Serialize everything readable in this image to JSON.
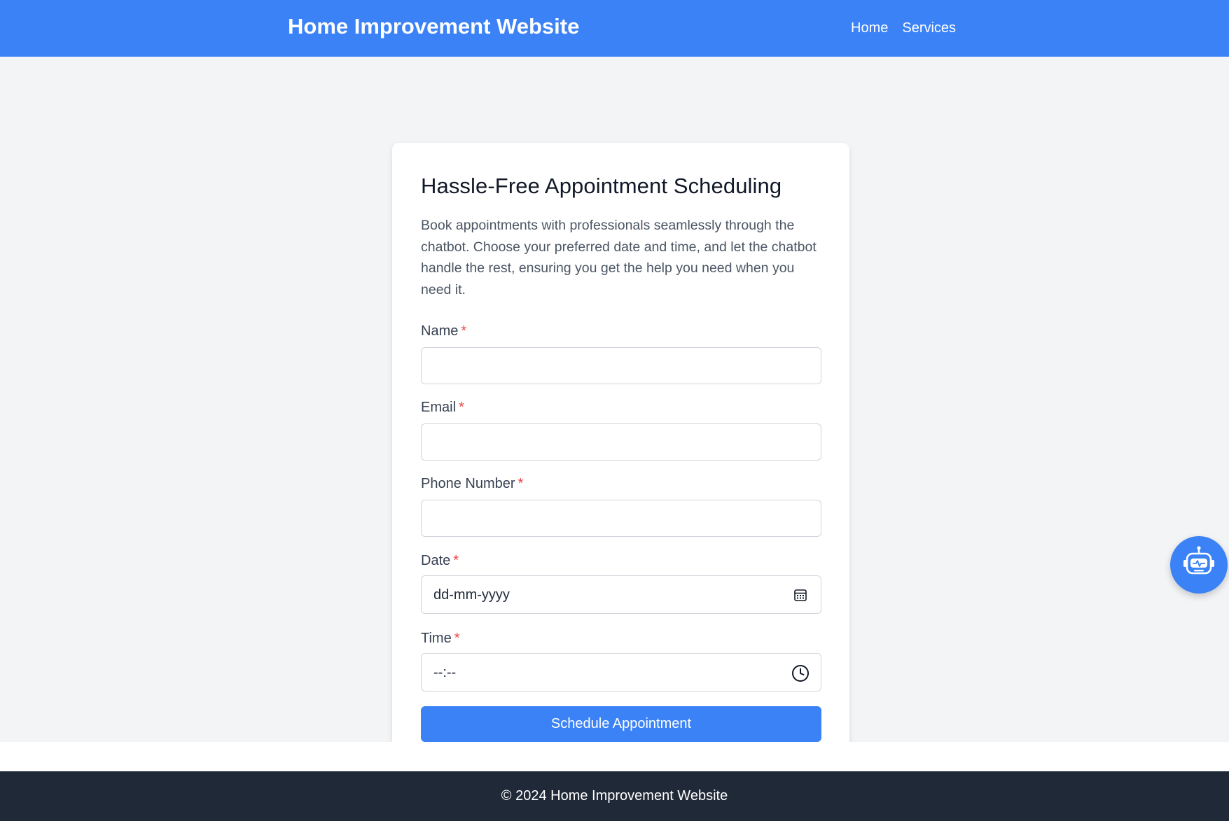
{
  "header": {
    "title": "Home Improvement Website",
    "nav": [
      "Home",
      "Services"
    ]
  },
  "card": {
    "title": "Hassle-Free Appointment Scheduling",
    "description": "Book appointments with professionals seamlessly through the chatbot. Choose your preferred date and time, and let the chatbot handle the rest, ensuring you get the help you need when you need it.",
    "fields": {
      "name": {
        "label": "Name",
        "required_mark": "*",
        "value": ""
      },
      "email": {
        "label": "Email",
        "required_mark": "*",
        "value": ""
      },
      "phone": {
        "label": "Phone Number",
        "required_mark": "*",
        "value": ""
      },
      "date": {
        "label": "Date",
        "required_mark": "*",
        "value": "dd-mm-yyyy",
        "icon": "calendar-icon"
      },
      "time": {
        "label": "Time",
        "required_mark": "*",
        "value": "--:--",
        "icon": "clock-icon"
      }
    },
    "submit_label": "Schedule Appointment"
  },
  "chatbot": {
    "icon": "robot-icon"
  },
  "footer": {
    "text": "© 2024 Home Improvement Website"
  },
  "colors": {
    "primary": "#3b82f6",
    "background": "#f3f4f6",
    "footer": "#1f2937",
    "required": "#ef4444"
  }
}
